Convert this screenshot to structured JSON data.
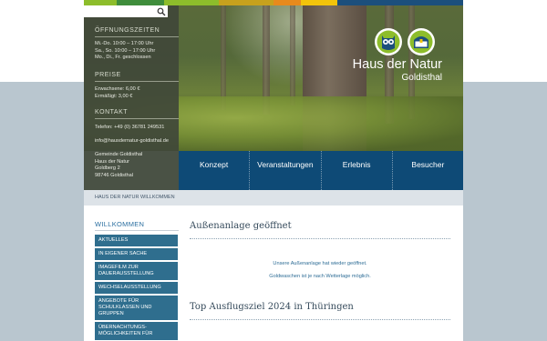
{
  "site": {
    "logo_title": "Haus der Natur",
    "logo_subtitle": "Goldisthal",
    "stripe_colors": [
      "#8dbd2b",
      "#3f8d3c",
      "#c7a11d",
      "#e78a1d",
      "#f2c40b",
      "#1c4f7c"
    ]
  },
  "search": {
    "placeholder": "",
    "icon": "search-icon"
  },
  "sidebar": {
    "hours_heading": "ÖFFNUNGSZEITEN",
    "hours": [
      "Mi.-Do. 10:00 – 17:00 Uhr",
      "Sa., So. 10:00 – 17:00 Uhr",
      "Mo., Di., Fr. geschlossen"
    ],
    "prices_heading": "PREISE",
    "prices": [
      "Erwachsene: 6,00 €",
      "Ermäßigt: 3,00 €"
    ],
    "contact_heading": "KONTAKT",
    "contact": [
      "Telefon: +49 (0) 36781 249531",
      "info@hausdernatur-goldisthal.de",
      "",
      "Gemeinde Goldisthal",
      "Haus der Natur",
      "Goldberg 2",
      "98746 Goldisthal"
    ]
  },
  "nav": {
    "items": [
      "Konzept",
      "Veranstaltungen",
      "Erlebnis",
      "Besucher"
    ]
  },
  "breadcrumb": "HAUS DER NATUR WILLKOMMEN",
  "left_menu": {
    "heading": "WILLKOMMEN",
    "items": [
      "AKTUELLES",
      "IN EIGENER SACHE",
      "IMAGEFILM ZUR DAUERAUSSTELLUNG",
      "WECHSELAUSSTELLUNG",
      "ANGEBOTE FÜR SCHULKLASSEN UND GRUPPEN",
      "ÜBERNACHTUNGS-MÖGLICHKEITEN FÜR"
    ]
  },
  "articles": [
    {
      "title": "Außenanlage geöffnet",
      "paragraphs": [
        "Unsere Außenanlage hat wieder geöffnet.",
        "Goldwaschen ist je nach Wetterlage möglich."
      ]
    },
    {
      "title": "Top Ausflugsziel 2024 in Thüringen",
      "paragraphs": []
    }
  ],
  "colors": {
    "nav_bg": "#0e4a76",
    "menu_bg": "#2f6e8e",
    "accent_text": "#2e6d96"
  }
}
